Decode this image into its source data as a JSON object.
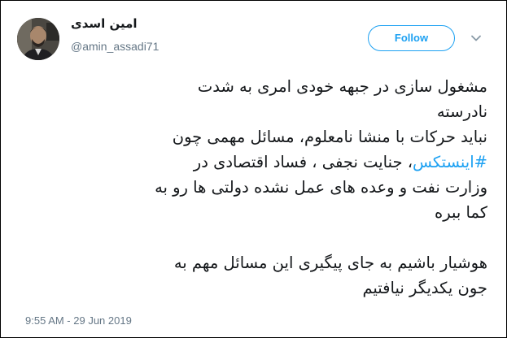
{
  "user": {
    "display_name": "امین اسدی",
    "handle": "@amin_assadi71",
    "avatar_icon": "profile-photo"
  },
  "follow_button": {
    "label": "Follow"
  },
  "menu": {
    "icon": "chevron-down-icon"
  },
  "tweet": {
    "line1": "مشغول سازی در جبهه خودی امری به شدت",
    "line2": "نادرسته",
    "line3": "نباید حرکات با منشا نامعلوم، مسائل مهمی چون",
    "line4_hashtag": "#اینستکس",
    "line4_rest": "، جنایت نجفی ، فساد اقتصادی در",
    "line5": "وزارت نفت و وعده های عمل نشده دولتی ها رو به",
    "line6": "کما ببره",
    "line8": "هوشیار باشیم به جای پیگیری این مسائل مهم به",
    "line9": "جون یکدیگر نیافتیم"
  },
  "timestamp": "9:55 AM - 29 Jun 2019",
  "colors": {
    "accent": "#1da1f2",
    "text": "#14171a",
    "secondary": "#657786"
  }
}
